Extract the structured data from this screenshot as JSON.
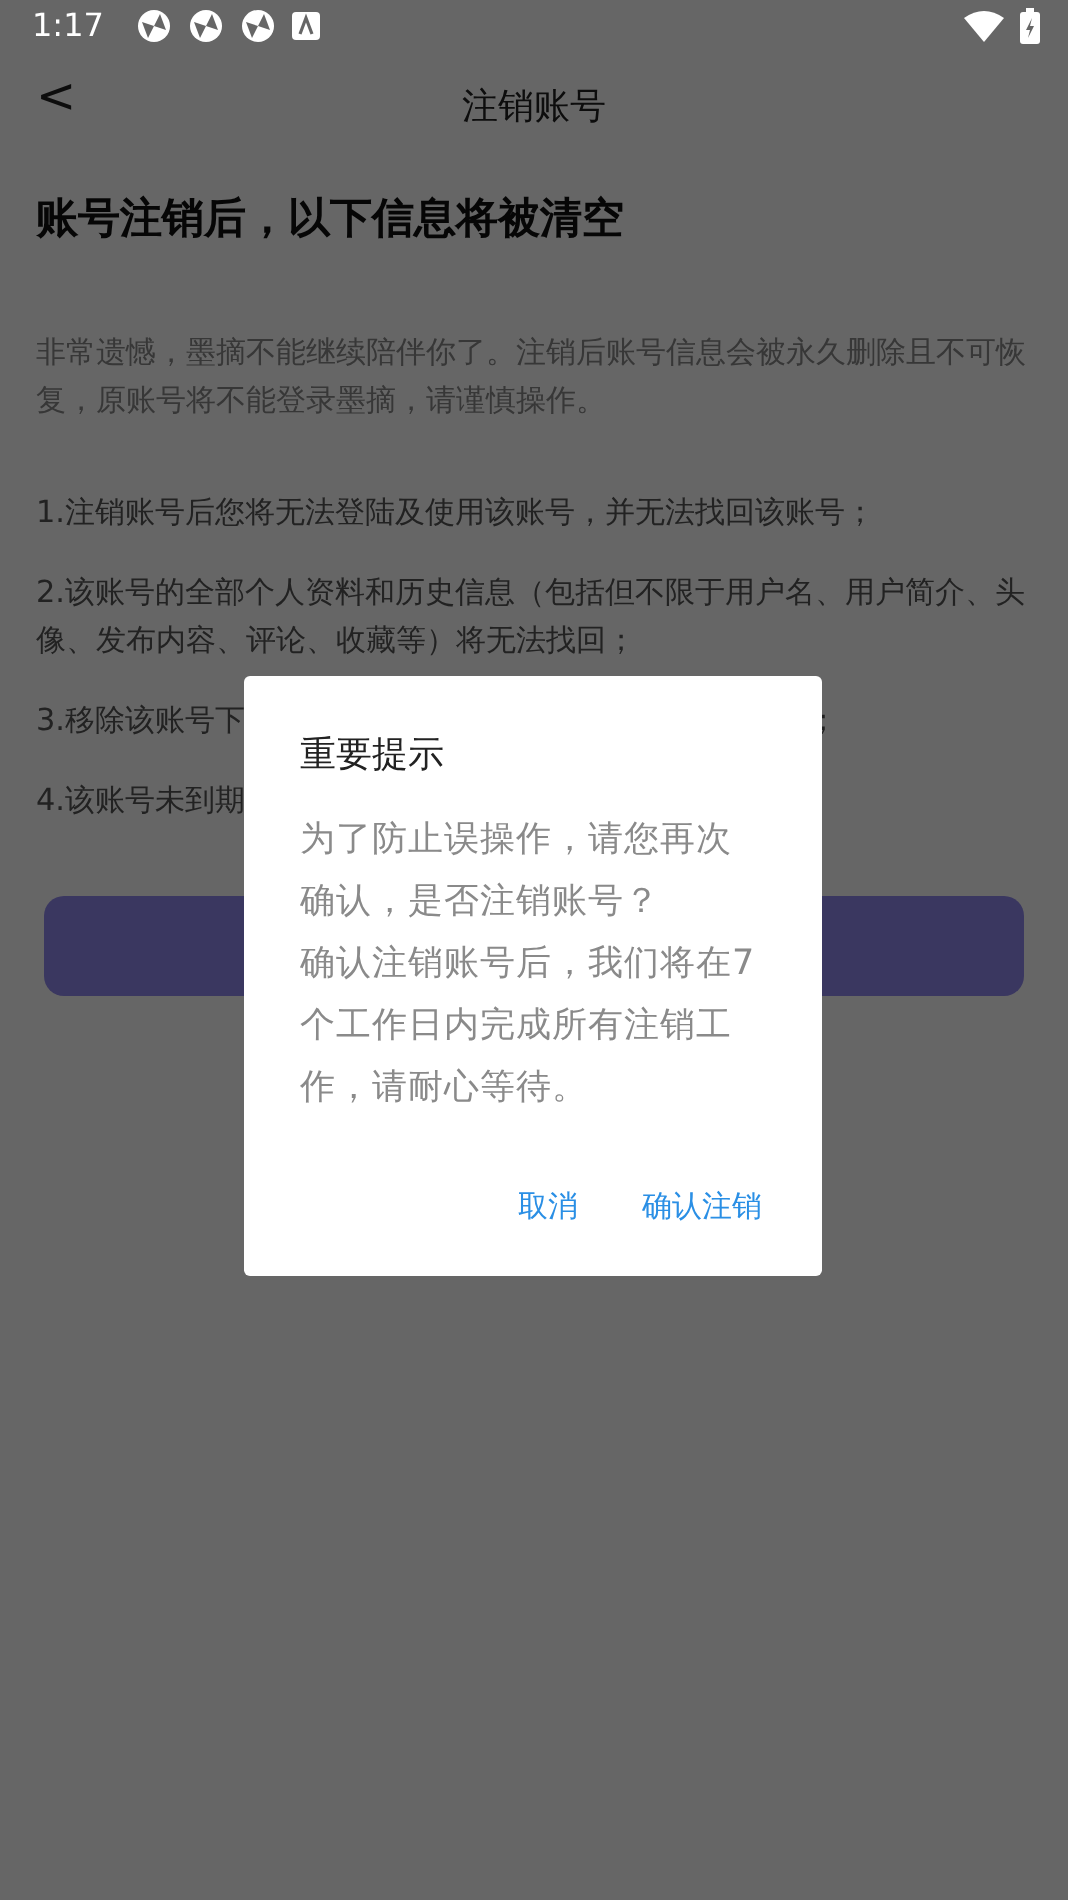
{
  "status_bar": {
    "time": "1:17"
  },
  "header": {
    "back": "<",
    "title": "注销账号"
  },
  "heading": "账号注销后，以下信息将被清空",
  "intro": "非常遗憾，墨摘不能继续陪伴你了。注销后账号信息会被永久删除且不可恢复，原账号将不能登录墨摘，请谨慎操作。",
  "items": [
    {
      "parts": [
        "1.注销账号后您将无法登陆及使用该账号，并无法找回该账号；"
      ]
    },
    {
      "parts": [
        " 2.该账号的全部个人资料和历史信息（包括但不限于用户名、用户简介、头像、发布内容、评论、收藏等）将无法找回；"
      ]
    },
    {
      "parts": [
        "3.移除该账号下",
        "；"
      ]
    },
    {
      "parts": [
        "4.该账号未到期"
      ]
    }
  ],
  "dialog": {
    "title": "重要提示",
    "message": [
      "为了防止误操作，请您再次确认，是否注销账号？",
      "确认注销账号后，我们将在7个工作日内完成所有注销工作，请耐心等待。"
    ],
    "buttons": [
      {
        "label": "取消"
      },
      {
        "label": "确认注销"
      }
    ]
  }
}
